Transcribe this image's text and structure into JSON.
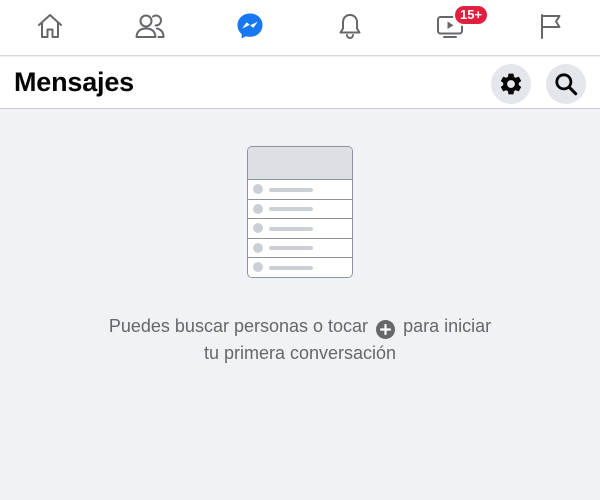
{
  "nav": {
    "items": [
      {
        "icon": "home-icon"
      },
      {
        "icon": "friends-icon"
      },
      {
        "icon": "messenger-icon",
        "active": true
      },
      {
        "icon": "bell-icon"
      },
      {
        "icon": "watch-icon",
        "badge": "15+"
      },
      {
        "icon": "flag-icon"
      }
    ]
  },
  "header": {
    "title": "Mensajes",
    "settings_icon": "gear-icon",
    "search_icon": "search-icon"
  },
  "empty_state": {
    "line1_before": "Puedes buscar personas o tocar",
    "line1_after": "para iniciar",
    "line2": "tu primera conversación",
    "inline_icon": "plus-circle-icon"
  },
  "colors": {
    "accent": "#1877f2",
    "badge": "#e41e3f",
    "background": "#f0f2f5",
    "secondary_text": "#65676b"
  }
}
